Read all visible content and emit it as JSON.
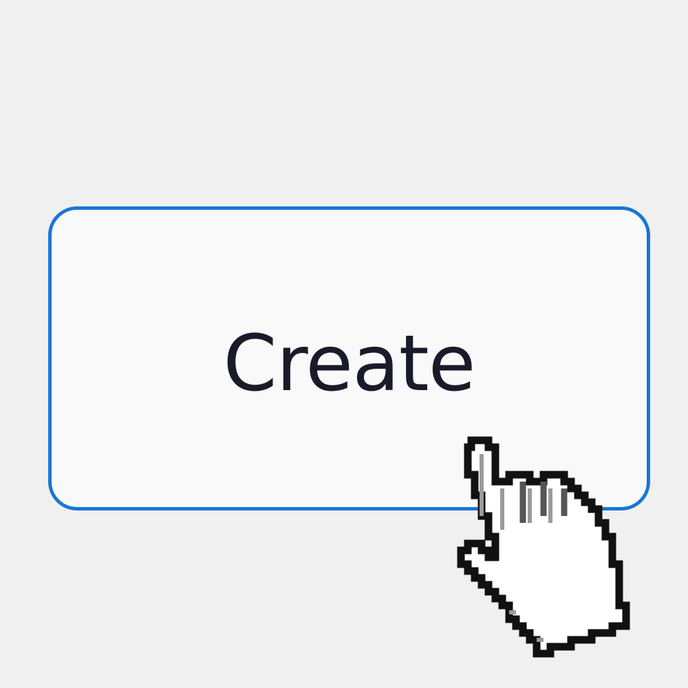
{
  "button": {
    "label": "Create"
  },
  "colors": {
    "background": "#f0f0f0",
    "button_fill": "#f9f9fa",
    "button_border": "#1976d6",
    "label_text": "#1a1a2a"
  },
  "cursor": {
    "icon": "hand-pointer-icon"
  }
}
